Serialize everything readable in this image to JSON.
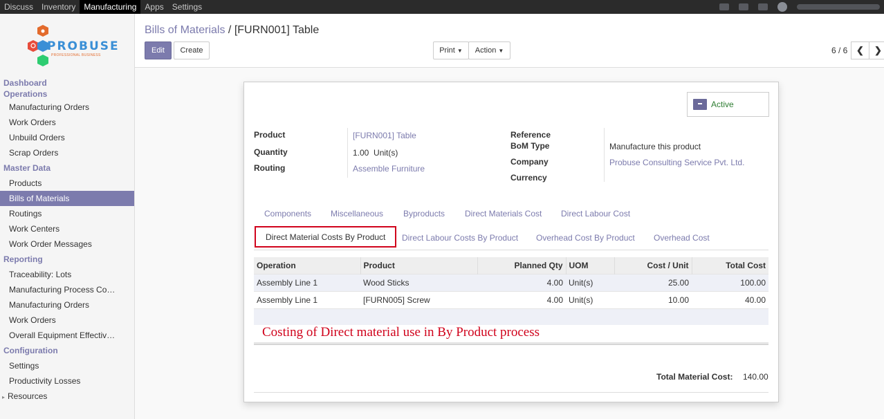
{
  "topbar": {
    "menu": [
      "Discuss",
      "Inventory",
      "Manufacturing",
      "Apps",
      "Settings"
    ],
    "active": "Manufacturing"
  },
  "logo": {
    "word": "PROBUSE",
    "sub": "PROFESSIONAL BUSINESS",
    "colors": [
      "#e36b2c",
      "#3a8fd6",
      "#2ecc71",
      "#e74c3c"
    ]
  },
  "sidebar": {
    "sections": [
      {
        "title": "Dashboard"
      },
      {
        "title": "Operations",
        "items": [
          "Manufacturing Orders",
          "Work Orders",
          "Unbuild Orders",
          "Scrap Orders"
        ]
      },
      {
        "title": "Master Data",
        "items": [
          "Products",
          "Bills of Materials",
          "Routings",
          "Work Centers",
          "Work Order Messages"
        ],
        "active": "Bills of Materials"
      },
      {
        "title": "Reporting",
        "items": [
          "Traceability: Lots",
          "Manufacturing Process Co…",
          "Manufacturing Orders",
          "Work Orders",
          "Overall Equipment Effectiv…"
        ]
      },
      {
        "title": "Configuration",
        "items": [
          "Settings",
          "Productivity Losses",
          "Resources"
        ]
      }
    ]
  },
  "control_panel": {
    "breadcrumb_parent": "Bills of Materials",
    "breadcrumb_sep": " / ",
    "breadcrumb_current": "[FURN001] Table",
    "edit_label": "Edit",
    "create_label": "Create",
    "print_label": "Print",
    "action_label": "Action",
    "pager": "6 / 6",
    "prev_glyph": "❮",
    "next_glyph": "❯"
  },
  "form": {
    "active_label": "Active",
    "left_fields": [
      {
        "label": "Product",
        "value": "[FURN001] Table",
        "link": true
      },
      {
        "label": "Quantity",
        "value": "1.00  Unit(s)",
        "link": false
      },
      {
        "label": "Routing",
        "value": "Assemble Furniture",
        "link": true
      }
    ],
    "right_fields": [
      {
        "label": "Reference",
        "value": ""
      },
      {
        "label": "BoM Type",
        "value": "Manufacture this product"
      },
      {
        "label": "Company",
        "value": "Probuse Consulting Service Pvt. Ltd."
      },
      {
        "label": "Currency",
        "value": ""
      }
    ],
    "tabs_row1": [
      "Components",
      "Miscellaneous",
      "Byproducts",
      "Direct Materials Cost",
      "Direct Labour Cost"
    ],
    "tabs_row2": [
      "Direct Material Costs By Product",
      "Direct Labour Costs By Product",
      "Overhead Cost By Product",
      "Overhead Cost"
    ],
    "selected_tab": "Direct Material Costs By Product",
    "table": {
      "columns": [
        "Operation",
        "Product",
        "Planned Qty",
        "UOM",
        "Cost / Unit",
        "Total Cost"
      ],
      "rows": [
        [
          "Assembly Line 1",
          "Wood Sticks",
          "4.00",
          "Unit(s)",
          "25.00",
          "100.00"
        ],
        [
          "Assembly Line 1",
          "[FURN005] Screw",
          "4.00",
          "Unit(s)",
          "10.00",
          "40.00"
        ]
      ]
    },
    "annotation": "Costing of Direct material use in By Product process",
    "total_label": "Total Material Cost:",
    "total_value": "140.00"
  },
  "colors": {
    "primary": "#7c7bad",
    "highlight_red": "#d0021b",
    "active_green": "#2e7d32",
    "topbar": "#2b2b2b"
  }
}
